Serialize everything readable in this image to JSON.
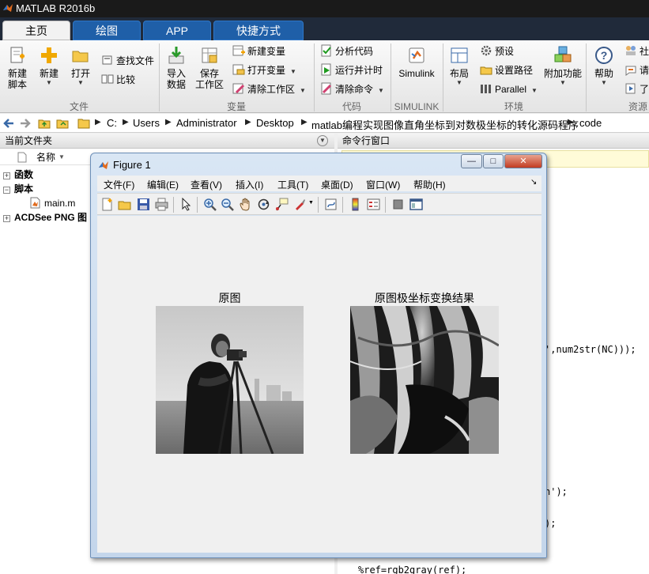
{
  "window": {
    "title": "MATLAB R2016b"
  },
  "tabs": [
    {
      "label": "主页",
      "active": true
    },
    {
      "label": "绘图"
    },
    {
      "label": "APP"
    },
    {
      "label": "快捷方式"
    }
  ],
  "ribbon": {
    "file": {
      "new_script": "新建\n脚本",
      "new": "新建",
      "open": "打开",
      "find_files": "查找文件",
      "compare": "比较",
      "section": "文件"
    },
    "variable": {
      "import": "导入\n数据",
      "save": "保存\n工作区",
      "new_variable": "新建变量",
      "open_variable": "打开变量",
      "clear_workspace": "清除工作区",
      "section": "变量"
    },
    "code": {
      "analyze": "分析代码",
      "run_time": "运行并计时",
      "clear_commands": "清除命令",
      "section": "代码"
    },
    "simulink": {
      "label": "Simulink",
      "section": "SIMULINK"
    },
    "environment": {
      "layout": "布局",
      "preferences": "预设",
      "set_path": "设置路径",
      "parallel": "Parallel",
      "addons": "附加功能",
      "section": "环境"
    },
    "resources": {
      "help": "帮助",
      "community": "社",
      "request": "请",
      "learn": "了",
      "section": "资源"
    }
  },
  "address": {
    "path": [
      "C:",
      "Users",
      "Administrator",
      "Desktop",
      "matlab编程实现图像直角坐标到对数极坐标的转化源码程序",
      "code"
    ]
  },
  "left_panel": {
    "title": "当前文件夹",
    "column_name": "名称",
    "tree": [
      {
        "label": "函数",
        "type": "folder",
        "expanded": false
      },
      {
        "label": "脚本",
        "type": "folder",
        "expanded": true
      },
      {
        "label": "main.m",
        "type": "file"
      },
      {
        "label": "ACDSee PNG 图",
        "type": "folder",
        "expanded": false
      }
    ]
  },
  "right_panel": {
    "title": "命令行窗口",
    "code_lines": [
      "',num2str(NC)));",
      "n');",
      ");",
      "%ref=rgb2gray(ref);"
    ]
  },
  "figure": {
    "title": "Figure 1",
    "menu": [
      "文件(F)",
      "编辑(E)",
      "查看(V)",
      "插入(I)",
      "工具(T)",
      "桌面(D)",
      "窗口(W)",
      "帮助(H)"
    ],
    "axes": [
      {
        "title": "原图"
      },
      {
        "title": "原图极坐标变换结果"
      }
    ],
    "window_buttons": {
      "minimize": "—",
      "maximize": "□",
      "close": "✕"
    }
  },
  "icons": {
    "toolbar": [
      "new-figure-icon",
      "open-file-icon",
      "save-icon",
      "print-icon",
      "pointer-icon",
      "zoom-in-icon",
      "zoom-out-icon",
      "pan-icon",
      "rotate-3d-icon",
      "data-cursor-icon",
      "brush-icon",
      "link-plot-icon",
      "colorbar-icon",
      "legend-icon",
      "hide-plot-tools-icon",
      "show-plot-tools-icon"
    ]
  }
}
